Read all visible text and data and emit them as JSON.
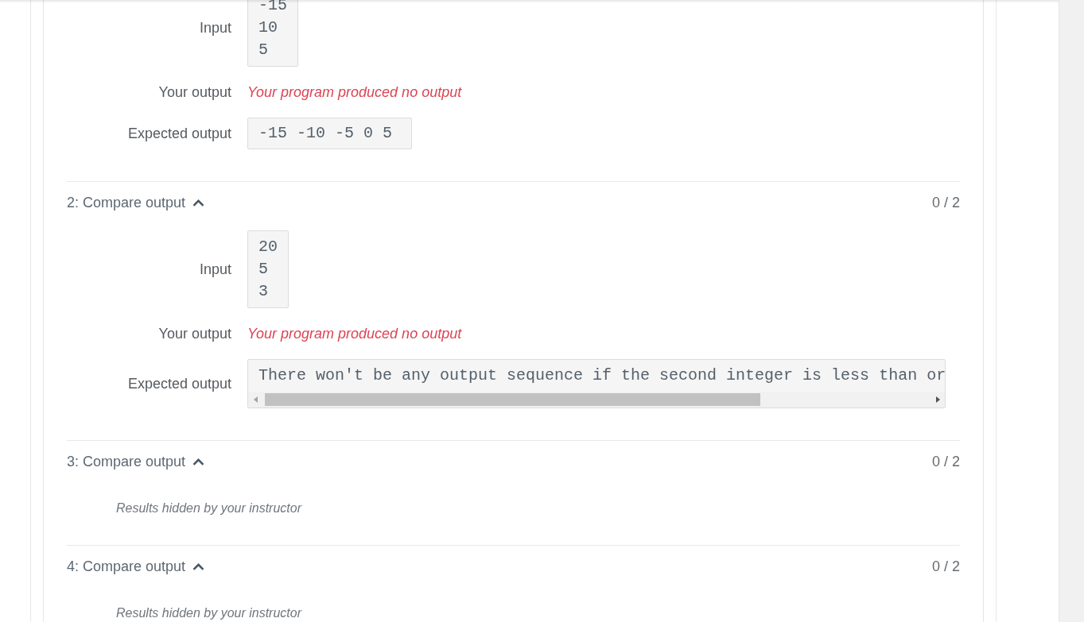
{
  "tests": [
    {
      "rows": [
        {
          "kind": "input",
          "label": "Input",
          "lines": [
            "-15",
            "10",
            "5"
          ]
        },
        {
          "kind": "message",
          "label": "Your output",
          "text": "Your program produced no output"
        },
        {
          "kind": "code",
          "label": "Expected output",
          "text": "-15 -10 -5 0 5"
        }
      ]
    },
    {
      "title": "2: Compare output",
      "expanded": true,
      "score": "0 / 2",
      "rows": [
        {
          "kind": "input",
          "label": "Input",
          "lines": [
            "20",
            "5",
            "3"
          ]
        },
        {
          "kind": "message",
          "label": "Your output",
          "text": "Your program produced no output"
        },
        {
          "kind": "scroll_code",
          "label": "Expected output",
          "text": "There won't be any output sequence if the second integer is less than or"
        }
      ]
    },
    {
      "title": "3: Compare output",
      "expanded": true,
      "score": "0 / 2",
      "note": "Results hidden by your instructor"
    },
    {
      "title": "4: Compare output",
      "expanded": true,
      "score": "0 / 2",
      "note": "Results hidden by your instructor"
    }
  ]
}
